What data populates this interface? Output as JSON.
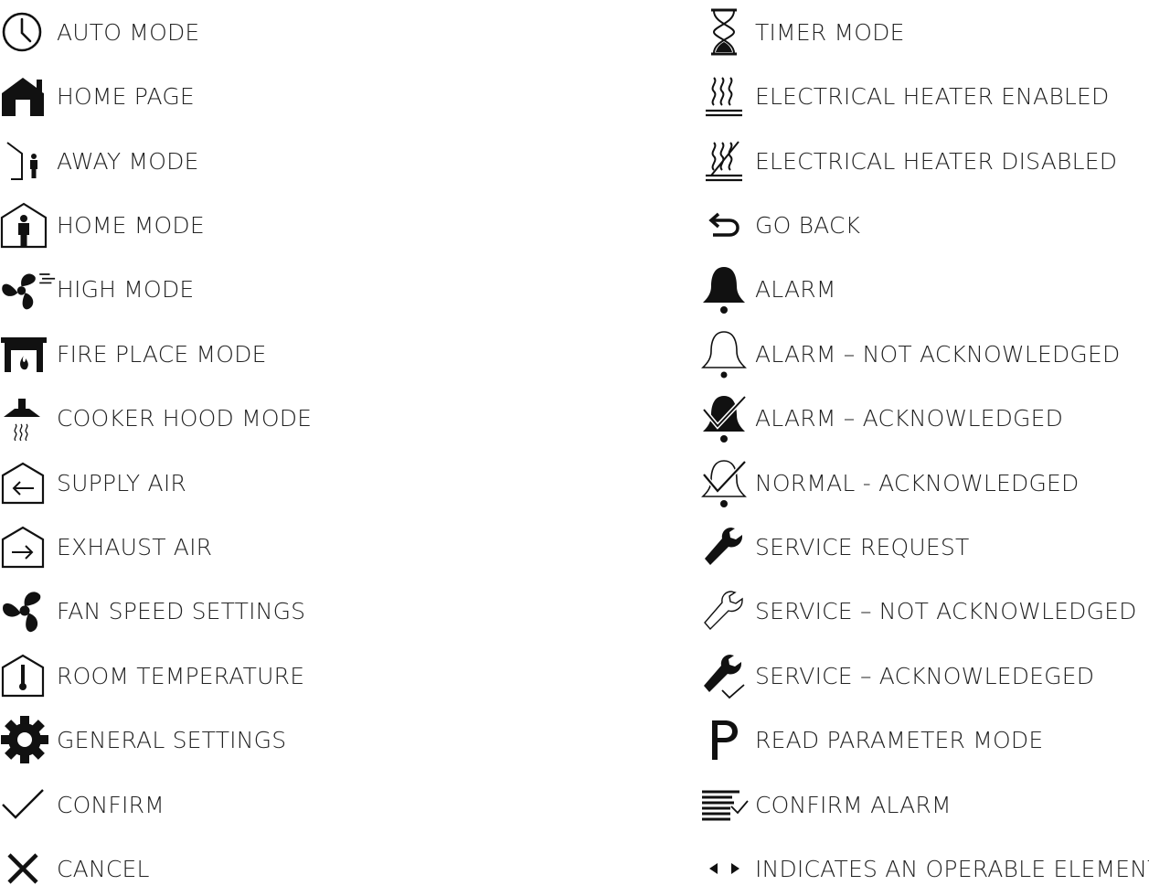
{
  "left": [
    {
      "label": "AUTO MODE",
      "icon": "clock-icon"
    },
    {
      "label": "HOME PAGE",
      "icon": "house-icon"
    },
    {
      "label": "AWAY MODE",
      "icon": "away-person-icon"
    },
    {
      "label": "HOME MODE",
      "icon": "home-person-icon"
    },
    {
      "label": "HIGH MODE",
      "icon": "fan-high-icon"
    },
    {
      "label": "FIRE PLACE MODE",
      "icon": "fireplace-icon"
    },
    {
      "label": "COOKER HOOD MODE",
      "icon": "cooker-hood-icon"
    },
    {
      "label": "SUPPLY AIR",
      "icon": "supply-air-icon"
    },
    {
      "label": "EXHAUST AIR",
      "icon": "exhaust-air-icon"
    },
    {
      "label": "FAN SPEED SETTINGS",
      "icon": "fan-icon"
    },
    {
      "label": "ROOM TEMPERATURE",
      "icon": "thermometer-icon"
    },
    {
      "label": "GENERAL SETTINGS",
      "icon": "gear-icon"
    },
    {
      "label": "CONFIRM",
      "icon": "checkmark-icon"
    },
    {
      "label": "CANCEL",
      "icon": "cross-icon"
    }
  ],
  "right": [
    {
      "label": "TIMER MODE",
      "icon": "hourglass-icon"
    },
    {
      "label": "ELECTRICAL HEATER ENABLED",
      "icon": "heater-enabled-icon"
    },
    {
      "label": "ELECTRICAL HEATER DISABLED",
      "icon": "heater-disabled-icon"
    },
    {
      "label": "GO BACK",
      "icon": "go-back-icon"
    },
    {
      "label": "ALARM",
      "icon": "bell-icon"
    },
    {
      "label": "ALARM – NOT ACKNOWLEDGED",
      "icon": "bell-outline-icon"
    },
    {
      "label": "ALARM – ACKNOWLEDGED",
      "icon": "bell-acknowledged-icon"
    },
    {
      "label": "NORMAL - ACKNOWLEDGED",
      "icon": "bell-normal-acknowledged-icon"
    },
    {
      "label": "SERVICE REQUEST",
      "icon": "wrench-icon"
    },
    {
      "label": "SERVICE – NOT ACKNOWLEDGED",
      "icon": "wrench-outline-icon"
    },
    {
      "label": "SERVICE – ACKNOWLEDEGED",
      "icon": "wrench-check-icon"
    },
    {
      "label": "READ PARAMETER MODE",
      "icon": "parameter-p-icon"
    },
    {
      "label": "CONFIRM ALARM",
      "icon": "confirm-alarm-icon"
    },
    {
      "label": "INDICATES AN OPERABLE ELEMENT",
      "icon": "arrows-left-right-icon"
    }
  ]
}
